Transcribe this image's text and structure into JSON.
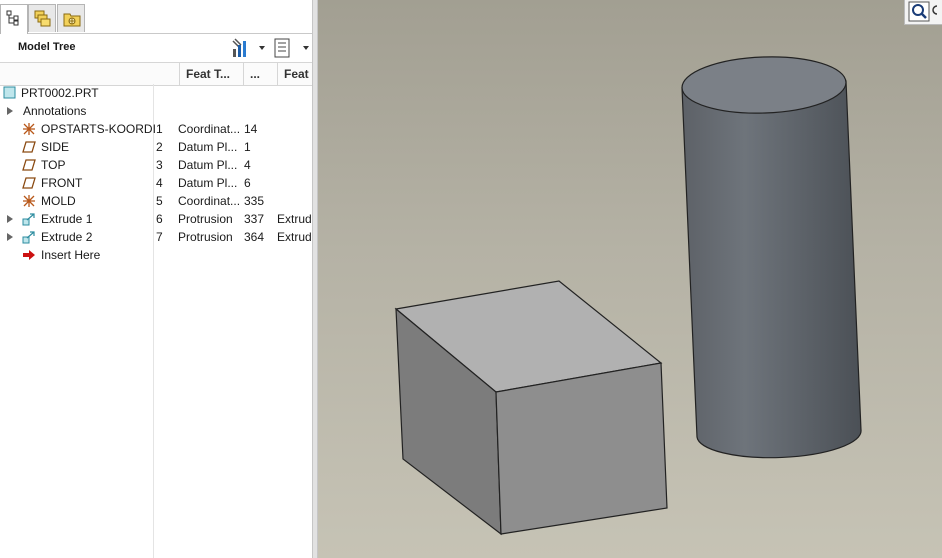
{
  "panel": {
    "title": "Model Tree",
    "tabs": [
      {
        "icon": "model-tree-icon",
        "active": true
      },
      {
        "icon": "folder-browser-icon",
        "active": false
      },
      {
        "icon": "favorites-icon",
        "active": false
      }
    ],
    "columns": [
      {
        "label": ""
      },
      {
        "label": "Feat T..."
      },
      {
        "label": "..."
      },
      {
        "label": "Feat"
      }
    ]
  },
  "tree": {
    "root": {
      "label": "PRT0002.PRT",
      "icon": "part-icon"
    },
    "annotations": {
      "label": "Annotations"
    },
    "items": [
      {
        "label": "OPSTARTS-KOORDI",
        "num": "1",
        "type": "Coordinat...",
        "id": "14",
        "feat": "",
        "icon": "coordinate-system-icon",
        "expandable": false
      },
      {
        "label": "SIDE",
        "num": "2",
        "type": "Datum Pl...",
        "id": "1",
        "feat": "",
        "icon": "datum-plane-icon",
        "expandable": false
      },
      {
        "label": "TOP",
        "num": "3",
        "type": "Datum Pl...",
        "id": "4",
        "feat": "",
        "icon": "datum-plane-icon",
        "expandable": false
      },
      {
        "label": "FRONT",
        "num": "4",
        "type": "Datum Pl...",
        "id": "6",
        "feat": "",
        "icon": "datum-plane-icon",
        "expandable": false
      },
      {
        "label": "MOLD",
        "num": "5",
        "type": "Coordinat...",
        "id": "335",
        "feat": "",
        "icon": "coordinate-system-icon",
        "expandable": false
      },
      {
        "label": "Extrude 1",
        "num": "6",
        "type": "Protrusion",
        "id": "337",
        "feat": "Extrud",
        "icon": "extrude-icon",
        "expandable": true
      },
      {
        "label": "Extrude 2",
        "num": "7",
        "type": "Protrusion",
        "id": "364",
        "feat": "Extrud",
        "icon": "extrude-icon",
        "expandable": true
      }
    ],
    "insert_here": {
      "label": "Insert Here",
      "icon": "insert-arrow-icon"
    }
  },
  "colors": {
    "insert_arrow": "#cc1111",
    "datum_plane": "#8a4a12",
    "coord_sys": "#b8581a",
    "part_fill": "#bfe6ec",
    "part_stroke": "#2d8da0"
  }
}
